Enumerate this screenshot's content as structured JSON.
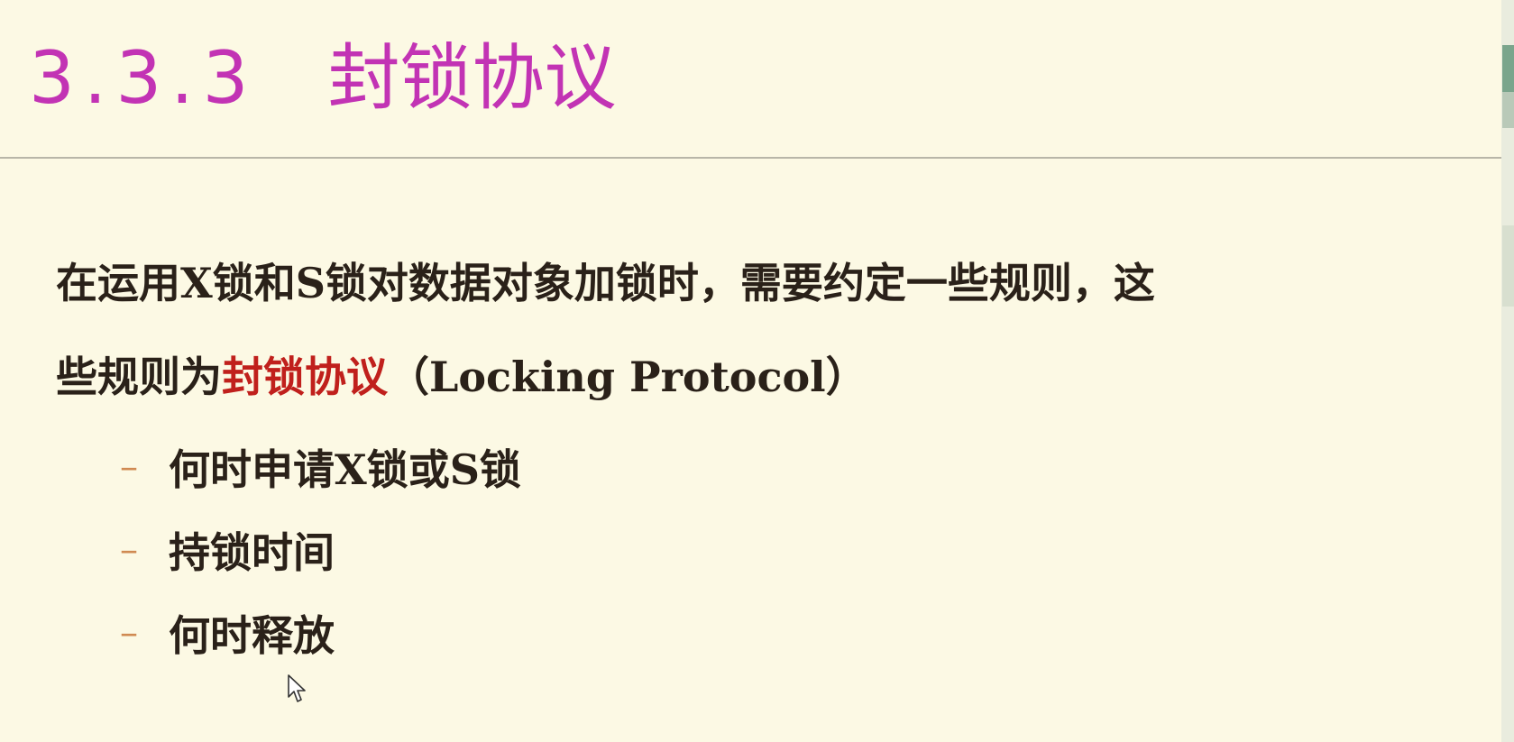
{
  "slide": {
    "title_number": "3.3.3",
    "title_text": "封锁协议",
    "intro_line1": "在运用X锁和S锁对数据对象加锁时，需要约定一些规则，这",
    "intro_line2_prefix": "些规则为",
    "intro_line2_highlight": "封锁协议",
    "intro_line2_suffix": "（Locking Protocol）",
    "bullet_marker": "–",
    "bullets": [
      "何时申请X锁或S锁",
      "持锁时间",
      "何时释放"
    ]
  },
  "colors": {
    "background": "#fcf9e4",
    "title": "#c233b4",
    "body_text": "#2a2119",
    "highlight": "#c0201c",
    "bullet_marker": "#d08a52"
  },
  "icons": {
    "cursor": "mouse-pointer-icon"
  }
}
